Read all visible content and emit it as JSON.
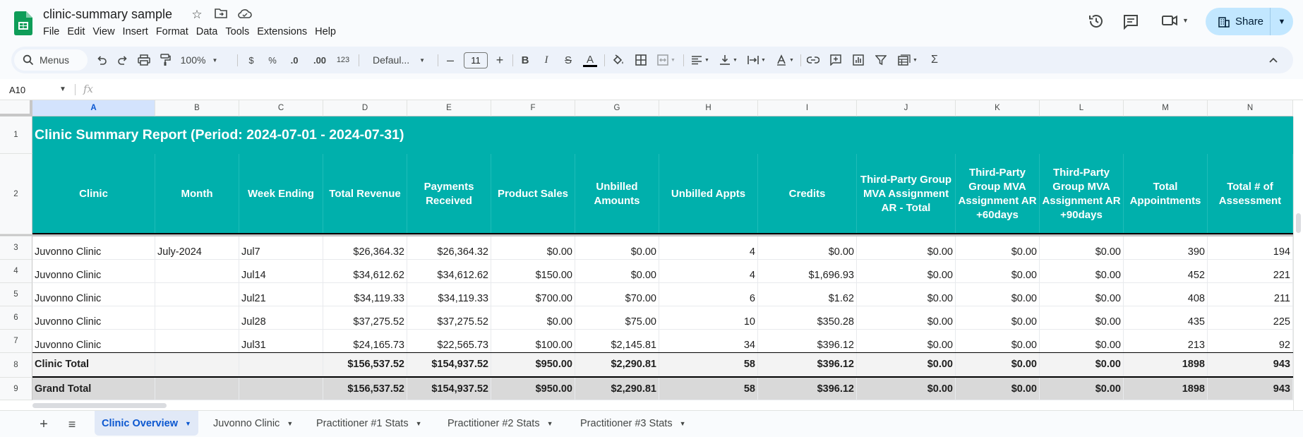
{
  "doc": {
    "title": "clinic-summary sample"
  },
  "menu": [
    "File",
    "Edit",
    "View",
    "Insert",
    "Format",
    "Data",
    "Tools",
    "Extensions",
    "Help"
  ],
  "header_actions": {
    "share_label": "Share"
  },
  "toolbar": {
    "menus_label": "Menus",
    "zoom": "100%",
    "currency": "$",
    "percent": "%",
    "dec_decrease": ".0",
    "dec_increase": ".00",
    "number_format": "123",
    "font": "Defaul...",
    "font_size": "11"
  },
  "formula_bar": {
    "cell_ref": "A10",
    "fx": "fx",
    "value": ""
  },
  "columns": [
    "A",
    "B",
    "C",
    "D",
    "E",
    "F",
    "G",
    "H",
    "I",
    "J",
    "K",
    "L",
    "M",
    "N"
  ],
  "selected_column": "A",
  "row_numbers": [
    "1",
    "2",
    "3",
    "4",
    "5",
    "6",
    "7",
    "8",
    "9"
  ],
  "sheet": {
    "title": "Clinic Summary Report (Period: 2024-07-01 - 2024-07-31)",
    "headers": [
      "Clinic",
      "Month",
      "Week Ending",
      "Total Revenue",
      "Payments Received",
      "Product Sales",
      "Unbilled Amounts",
      "Unbilled Appts",
      "Credits",
      "Third-Party Group MVA Assignment AR - Total",
      "Third-Party Group MVA Assignment AR +60days",
      "Third-Party Group MVA Assignment AR +90days",
      "Total Appointments",
      "Total # of Assessment"
    ],
    "rows": [
      [
        "Juvonno Clinic",
        "July-2024",
        "Jul7",
        "$26,364.32",
        "$26,364.32",
        "$0.00",
        "$0.00",
        "4",
        "$0.00",
        "$0.00",
        "$0.00",
        "$0.00",
        "390",
        "194"
      ],
      [
        "Juvonno Clinic",
        "",
        "Jul14",
        "$34,612.62",
        "$34,612.62",
        "$150.00",
        "$0.00",
        "4",
        "$1,696.93",
        "$0.00",
        "$0.00",
        "$0.00",
        "452",
        "221"
      ],
      [
        "Juvonno Clinic",
        "",
        "Jul21",
        "$34,119.33",
        "$34,119.33",
        "$700.00",
        "$70.00",
        "6",
        "$1.62",
        "$0.00",
        "$0.00",
        "$0.00",
        "408",
        "211"
      ],
      [
        "Juvonno Clinic",
        "",
        "Jul28",
        "$37,275.52",
        "$37,275.52",
        "$0.00",
        "$75.00",
        "10",
        "$350.28",
        "$0.00",
        "$0.00",
        "$0.00",
        "435",
        "225"
      ],
      [
        "Juvonno Clinic",
        "",
        "Jul31",
        "$24,165.73",
        "$22,565.73",
        "$100.00",
        "$2,145.81",
        "34",
        "$396.12",
        "$0.00",
        "$0.00",
        "$0.00",
        "213",
        "92"
      ]
    ],
    "clinic_total": [
      "Clinic Total",
      "",
      "",
      "$156,537.52",
      "$154,937.52",
      "$950.00",
      "$2,290.81",
      "58",
      "$396.12",
      "$0.00",
      "$0.00",
      "$0.00",
      "1898",
      "943"
    ],
    "grand_total": [
      "Grand Total",
      "",
      "",
      "$156,537.52",
      "$154,937.52",
      "$950.00",
      "$2,290.81",
      "58",
      "$396.12",
      "$0.00",
      "$0.00",
      "$0.00",
      "1898",
      "943"
    ]
  },
  "sheet_tabs": [
    {
      "label": "Clinic Overview",
      "active": true
    },
    {
      "label": "Juvonno Clinic",
      "active": false
    },
    {
      "label": "Practitioner #1 Stats",
      "active": false
    },
    {
      "label": "Practitioner #2 Stats",
      "active": false
    },
    {
      "label": "Practitioner #3 Stats",
      "active": false
    }
  ],
  "colors": {
    "header_teal": "#00b0ac",
    "accent_blue": "#0b57d0",
    "share_bg": "#c2e7ff"
  }
}
